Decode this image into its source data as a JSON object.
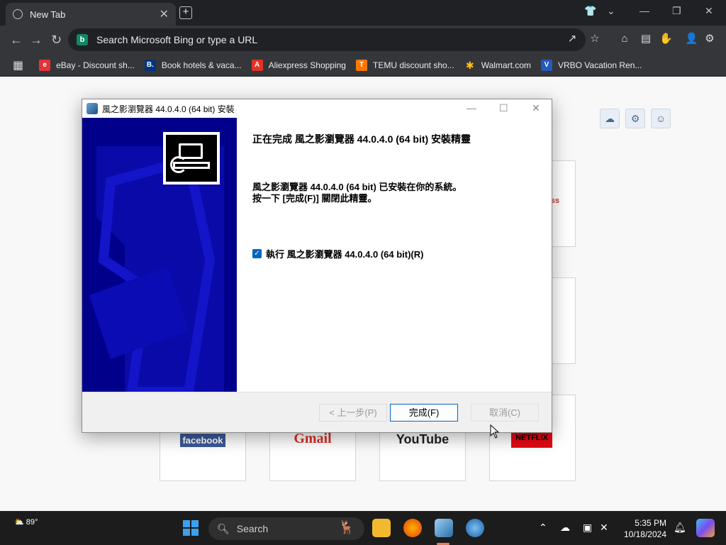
{
  "browser": {
    "tab_title": "New Tab",
    "tab_close": "✕",
    "new_tab": "+",
    "address_placeholder": "Search Microsoft Bing or type a URL",
    "bookmarks": [
      {
        "label": "eBay - Discount sh...",
        "color": "#e53238",
        "glyph": "e"
      },
      {
        "label": "Book hotels & vaca...",
        "color": "#003580",
        "glyph": "B."
      },
      {
        "label": "Aliexpress Shopping",
        "color": "#e43225",
        "glyph": "A"
      },
      {
        "label": "TEMU discount sho...",
        "color": "#fb7701",
        "glyph": "T"
      },
      {
        "label": "Walmart.com",
        "color": "#ffc220",
        "glyph": "✱"
      },
      {
        "label": "VRBO Vacation Ren...",
        "color": "#245abc",
        "glyph": "V"
      }
    ]
  },
  "tiles": {
    "facebook": "facebook",
    "gmail": "Gmail",
    "youtube": "YouTube",
    "netflix": "NETFLIX"
  },
  "dialog": {
    "title": "風之影瀏覽器 44.0.4.0 (64 bit) 安裝",
    "heading": "正在完成 風之影瀏覽器 44.0.4.0 (64 bit) 安裝精靈",
    "message_line1": "風之影瀏覽器 44.0.4.0 (64 bit) 已安裝在你的系統。",
    "message_line2": "按一下 [完成(F)] 關閉此精靈。",
    "checkbox_label": "執行 風之影瀏覽器 44.0.4.0 (64 bit)(R)",
    "checkbox_checked": true,
    "back_button": "< 上一步(P)",
    "finish_button": "完成(F)",
    "cancel_button": "取消(C)"
  },
  "taskbar": {
    "weather_temp": "89°",
    "search_label": "Search",
    "time": "5:35 PM",
    "date": "10/18/2024"
  }
}
